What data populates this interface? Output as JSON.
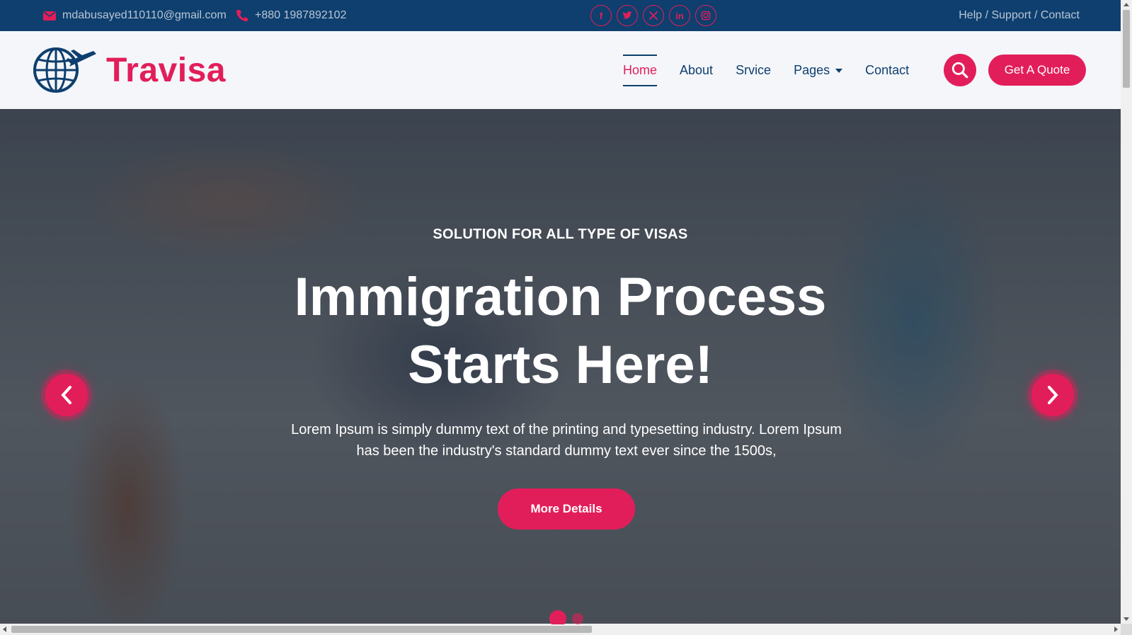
{
  "topbar": {
    "email": "mdabusayed110110@gmail.com",
    "phone": "+880 1987892102",
    "socials": [
      {
        "icon": "facebook-icon",
        "glyph": "f"
      },
      {
        "icon": "twitter-icon",
        "glyph": "🐦"
      },
      {
        "icon": "x-icon",
        "glyph": "𝕏"
      },
      {
        "icon": "linkedin-icon",
        "glyph": "in"
      },
      {
        "icon": "instagram-icon",
        "glyph": "◎"
      }
    ],
    "help_links": "Help / Support / Contact"
  },
  "brand": {
    "name": "Travisa",
    "accent": "#e21e5a",
    "navy": "#0e3f6e"
  },
  "nav": {
    "items": [
      {
        "label": "Home",
        "active": true
      },
      {
        "label": "About"
      },
      {
        "label": "Srvice"
      },
      {
        "label": "Pages",
        "dropdown": true
      },
      {
        "label": "Contact"
      }
    ],
    "cta": "Get A Quote"
  },
  "hero": {
    "subtitle": "SOLUTION FOR ALL TYPE OF VISAS",
    "title_line1": "Immigration Process",
    "title_line2": "Starts Here!",
    "description": "Lorem Ipsum is simply dummy text of the printing and typesetting industry. Lorem Ipsum has been the industry's standard dummy text ever since the 1500s,",
    "button": "More Details",
    "slides_total": 2,
    "active_slide": 1
  }
}
